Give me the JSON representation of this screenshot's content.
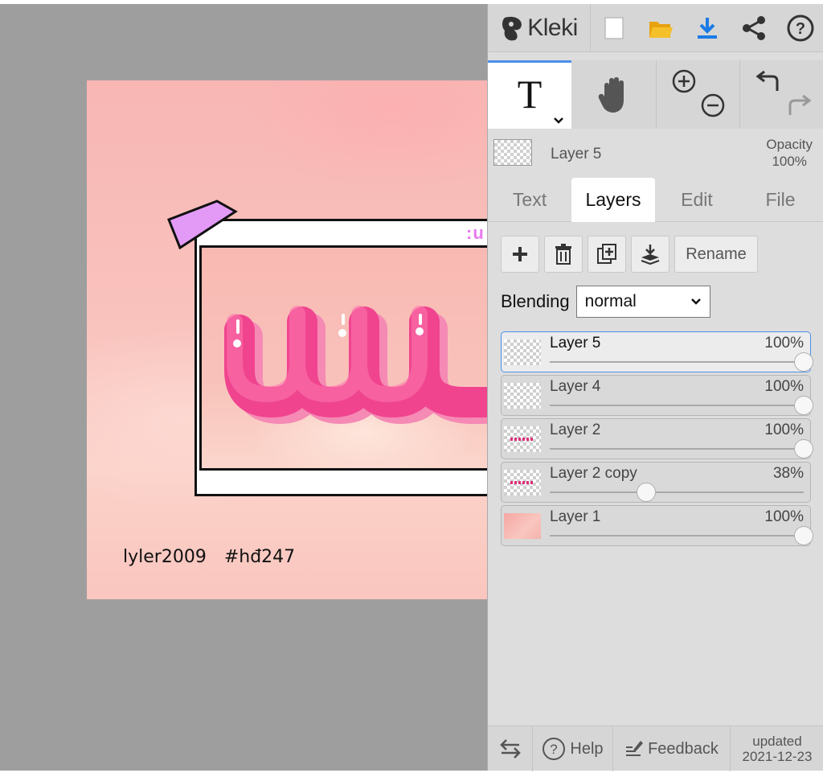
{
  "app": {
    "name": "Kleki"
  },
  "canvas": {
    "overlay_text": ":u",
    "signature_user": "lyler2009",
    "signature_tag": "#hđ247",
    "colors": {
      "tape": "#e39af6",
      "letters": "#f0448f"
    }
  },
  "toolbar": {
    "icons": [
      "new-image-icon",
      "open-folder-icon",
      "download-icon",
      "share-icon",
      "help-icon"
    ],
    "accent": "#4c8fe8"
  },
  "tools": {
    "text_glyph": "T",
    "icons": [
      "text-tool-icon",
      "hand-tool-icon",
      "zoom-in-icon",
      "zoom-out-icon",
      "undo-icon",
      "redo-icon"
    ]
  },
  "current_layer": {
    "name": "Layer 5",
    "opacity_label": "Opacity",
    "opacity_value": "100%"
  },
  "tabs": [
    {
      "label": "Text",
      "active": false
    },
    {
      "label": "Layers",
      "active": true
    },
    {
      "label": "Edit",
      "active": false
    },
    {
      "label": "File",
      "active": false
    }
  ],
  "layer_actions": {
    "rename_label": "Rename"
  },
  "blending": {
    "label": "Blending",
    "value": "normal"
  },
  "layers": [
    {
      "name": "Layer 5",
      "opacity_text": "100%",
      "opacity": 1.0,
      "selected": true,
      "thumb": "empty"
    },
    {
      "name": "Layer 4",
      "opacity_text": "100%",
      "opacity": 1.0,
      "selected": false,
      "thumb": "empty"
    },
    {
      "name": "Layer 2",
      "opacity_text": "100%",
      "opacity": 1.0,
      "selected": false,
      "thumb": "pinkdots"
    },
    {
      "name": "Layer 2 copy",
      "opacity_text": "38%",
      "opacity": 0.38,
      "selected": false,
      "thumb": "pinkdots"
    },
    {
      "name": "Layer 1",
      "opacity_text": "100%",
      "opacity": 1.0,
      "selected": false,
      "thumb": "photo"
    }
  ],
  "footer": {
    "help_label": "Help",
    "feedback_label": "Feedback",
    "updated_label": "updated",
    "updated_date": "2021-12-23"
  }
}
